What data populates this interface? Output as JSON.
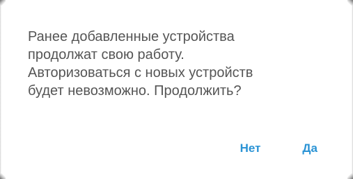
{
  "dialog": {
    "message": "Ранее добавленные устройства\nпродолжат свою работу.\nАвторизоваться с новых устройств\nбудет невозможно. Продолжить?",
    "buttons": {
      "no_label": "Нет",
      "yes_label": "Да"
    }
  },
  "colors": {
    "accent": "#2a93d5",
    "text": "#555555",
    "background": "#ffffff"
  }
}
